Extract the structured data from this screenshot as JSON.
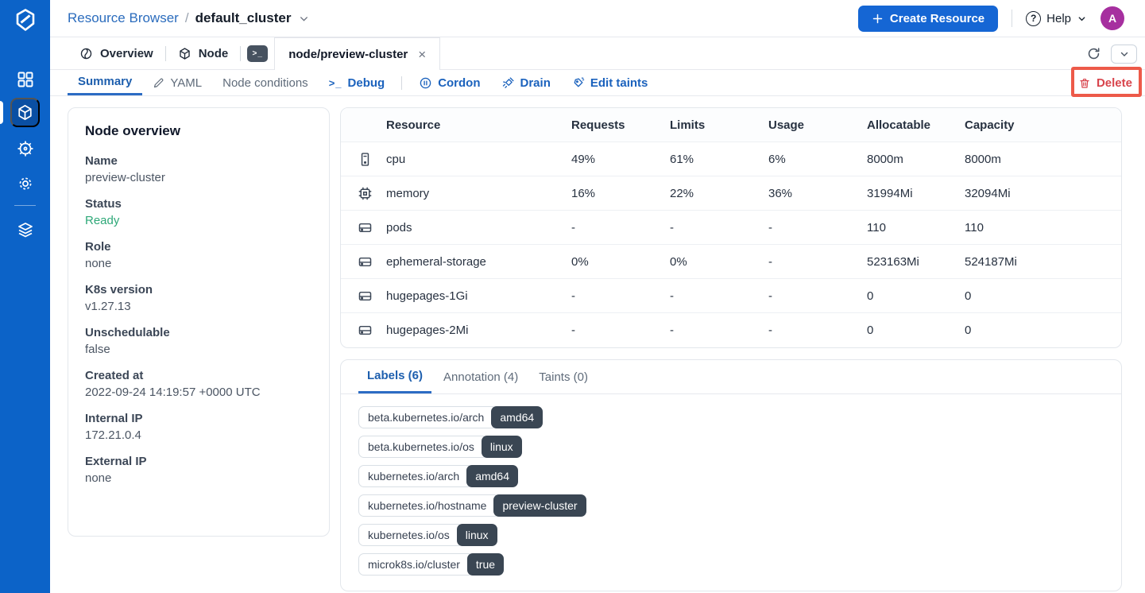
{
  "header": {
    "breadcrumb": {
      "app": "Resource Browser",
      "separator": "/",
      "cluster": "default_cluster"
    },
    "create_button": "Create Resource",
    "help_label": "Help",
    "avatar_initial": "A"
  },
  "tabbar": {
    "overview_tab": "Overview",
    "node_tab": "Node",
    "terminal_glyph": ">_",
    "active_tab": "node/preview-cluster",
    "close_glyph": "×"
  },
  "toolbar": {
    "summary": "Summary",
    "yaml": "YAML",
    "node_conditions": "Node conditions",
    "debug": "Debug",
    "debug_glyph": ">_",
    "cordon": "Cordon",
    "drain": "Drain",
    "edit_taints": "Edit taints",
    "delete_label": "Delete"
  },
  "overview_card": {
    "title": "Node overview",
    "fields": [
      {
        "label": "Name",
        "value": "preview-cluster"
      },
      {
        "label": "Status",
        "value": "Ready"
      },
      {
        "label": "Role",
        "value": "none"
      },
      {
        "label": "K8s version",
        "value": "v1.27.13"
      },
      {
        "label": "Unschedulable",
        "value": "false"
      },
      {
        "label": "Created at",
        "value": "2022-09-24 14:19:57 +0000 UTC"
      },
      {
        "label": "Internal IP",
        "value": "172.21.0.4"
      },
      {
        "label": "External IP",
        "value": "none"
      }
    ]
  },
  "resource_table": {
    "columns": [
      "Resource",
      "Requests",
      "Limits",
      "Usage",
      "Allocatable",
      "Capacity"
    ],
    "rows": [
      {
        "icon": "cpu-icon",
        "name": "cpu",
        "requests": "49%",
        "limits": "61%",
        "usage": "6%",
        "allocatable": "8000m",
        "capacity": "8000m"
      },
      {
        "icon": "memory-icon",
        "name": "memory",
        "requests": "16%",
        "limits": "22%",
        "usage": "36%",
        "allocatable": "31994Mi",
        "capacity": "32094Mi"
      },
      {
        "icon": "drive-icon",
        "name": "pods",
        "requests": "-",
        "limits": "-",
        "usage": "-",
        "allocatable": "110",
        "capacity": "110"
      },
      {
        "icon": "drive-icon",
        "name": "ephemeral-storage",
        "requests": "0%",
        "limits": "0%",
        "usage": "-",
        "allocatable": "523163Mi",
        "capacity": "524187Mi"
      },
      {
        "icon": "drive-icon",
        "name": "hugepages-1Gi",
        "requests": "-",
        "limits": "-",
        "usage": "-",
        "allocatable": "0",
        "capacity": "0"
      },
      {
        "icon": "drive-icon",
        "name": "hugepages-2Mi",
        "requests": "-",
        "limits": "-",
        "usage": "-",
        "allocatable": "0",
        "capacity": "0"
      }
    ]
  },
  "meta_card": {
    "tabs": [
      {
        "label": "Labels (6)"
      },
      {
        "label": "Annotation (4)"
      },
      {
        "label": "Taints (0)"
      }
    ],
    "labels": [
      {
        "key": "beta.kubernetes.io/arch",
        "value": "amd64"
      },
      {
        "key": "beta.kubernetes.io/os",
        "value": "linux"
      },
      {
        "key": "kubernetes.io/arch",
        "value": "amd64"
      },
      {
        "key": "kubernetes.io/hostname",
        "value": "preview-cluster"
      },
      {
        "key": "kubernetes.io/os",
        "value": "linux"
      },
      {
        "key": "microk8s.io/cluster",
        "value": "true"
      }
    ]
  },
  "colors": {
    "sidebar_blue": "#0c63c8",
    "sidebar_active_box": "#0a4fa3",
    "button_blue": "#1566d4",
    "action_blue": "#1b62bd",
    "status_green": "#2ea878",
    "delete_red": "#d8444c",
    "annotation_red": "#ed5a49",
    "avatar_purple": "#a62f9f",
    "badge_dark": "#3a4653"
  }
}
